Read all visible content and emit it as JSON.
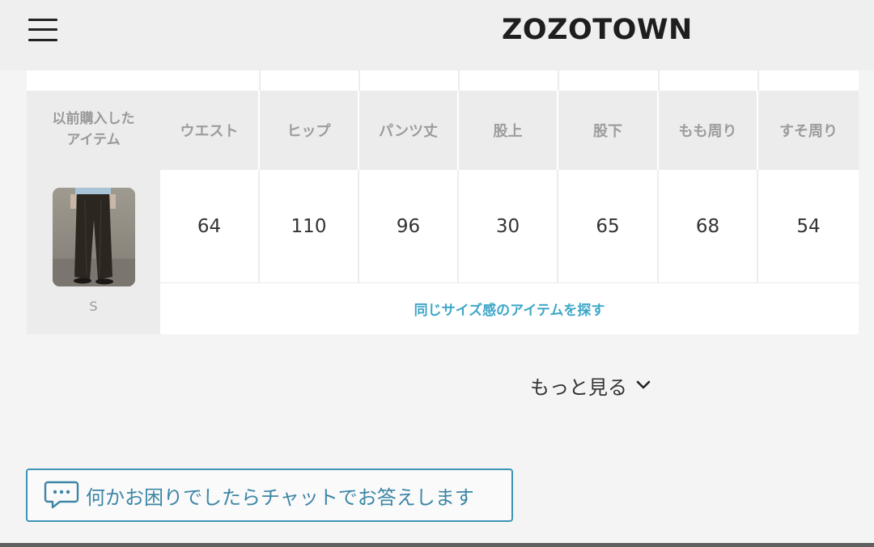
{
  "header": {
    "logo": "ZOZOTOWN",
    "menu_icon": "hamburger-menu-icon"
  },
  "size_table": {
    "previous_item_title_line1": "以前購入した",
    "previous_item_title_line2": "アイテム",
    "columns": [
      "ウエスト",
      "ヒップ",
      "パンツ丈",
      "股上",
      "股下",
      "もも周り",
      "すそ周り"
    ],
    "values": [
      "64",
      "110",
      "96",
      "30",
      "65",
      "68",
      "54"
    ],
    "item_size": "S",
    "same_size_link": "同じサイズ感のアイテムを探す"
  },
  "more": {
    "label": "もっと見る",
    "icon": "chevron-down-icon"
  },
  "chat": {
    "label": "何かお困りでしたらチャットでお答えします",
    "icon": "chat-bubble-icon"
  },
  "colors": {
    "link_blue": "#3ea7c9",
    "chat_border": "#3d94b6",
    "header_bg": "#efefef",
    "cell_header_bg": "#ececec"
  }
}
